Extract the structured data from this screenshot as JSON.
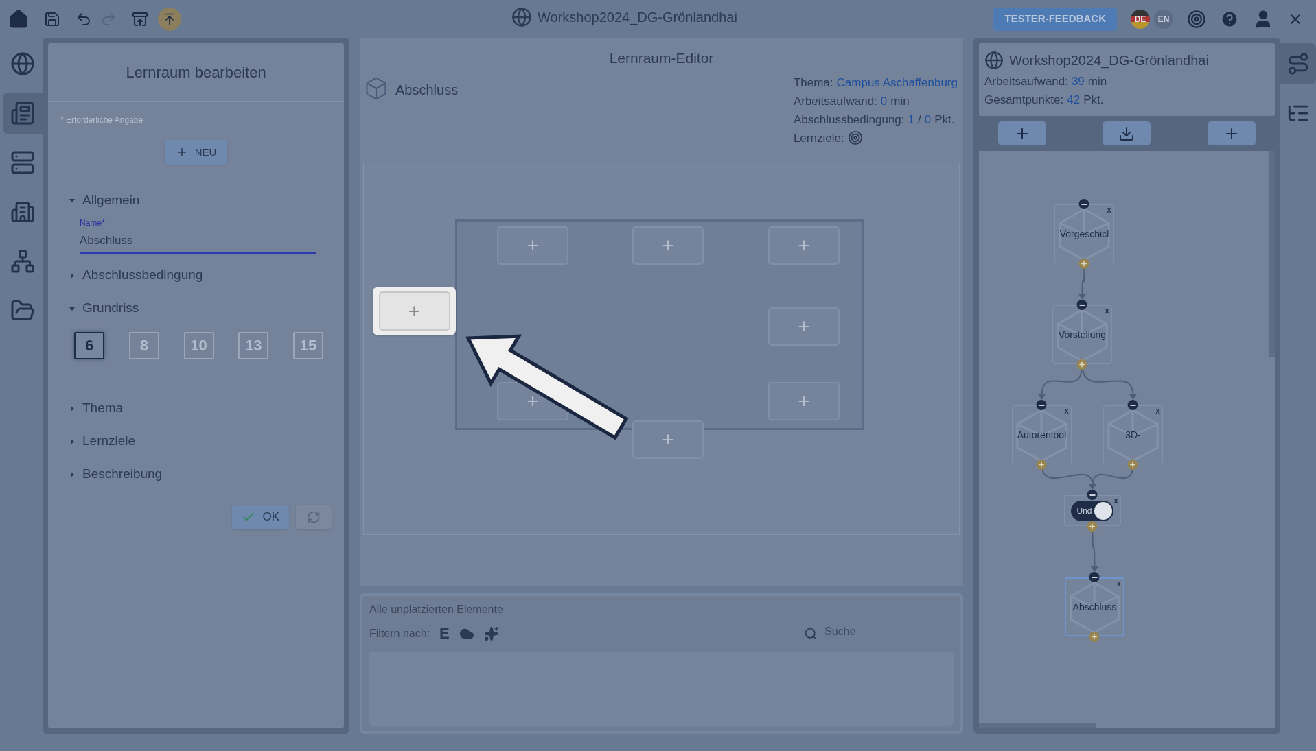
{
  "top_bar": {
    "title": "Workshop2024_DG-Grönlandhai",
    "feedback_button": "TESTER-FEEDBACK",
    "languages": [
      {
        "label": "DE",
        "selected": true
      },
      {
        "label": "EN",
        "selected": false
      }
    ],
    "redo_disabled": true
  },
  "left_rail": [
    {
      "selected": false
    },
    {
      "selected": true
    },
    {
      "selected": false
    },
    {
      "selected": false
    },
    {
      "selected": false
    },
    {
      "selected": false
    }
  ],
  "edit_panel": {
    "title": "Lernraum bearbeiten",
    "required_note": "* Erforderliche Angabe",
    "new_button": "NEU",
    "sections": [
      {
        "title": "Allgemein",
        "expanded": true,
        "kind": "general"
      },
      {
        "title": "Abschlussbedingung",
        "expanded": false
      },
      {
        "title": "Grundriss",
        "expanded": true,
        "kind": "floorplan"
      },
      {
        "title": "Thema",
        "expanded": false
      },
      {
        "title": "Lernziele",
        "expanded": false
      },
      {
        "title": "Beschreibung",
        "expanded": false
      }
    ],
    "name_field": {
      "label": "Name*",
      "value": "Abschluss"
    },
    "floorplans": [
      {
        "label": "6",
        "selected": true
      },
      {
        "label": "8",
        "selected": false
      },
      {
        "label": "10",
        "selected": false
      },
      {
        "label": "13",
        "selected": false
      },
      {
        "label": "15",
        "selected": false
      }
    ],
    "ok_button": "OK"
  },
  "editor": {
    "title": "Lernraum-Editor",
    "room_name": "Abschluss",
    "info": [
      [
        {
          "text": "Thema:",
          "kind": "label"
        },
        {
          "text": "Campus Aschaffenburg",
          "kind": "value"
        }
      ],
      [
        {
          "text": "Arbeitsaufwand:",
          "kind": "label"
        },
        {
          "text": "0",
          "kind": "value"
        },
        {
          "text": "min",
          "kind": "label"
        }
      ],
      [
        {
          "text": "Abschlussbedingung:",
          "kind": "label"
        },
        {
          "text": "1",
          "kind": "value"
        },
        {
          "text": "/",
          "kind": "label"
        },
        {
          "text": "0",
          "kind": "value"
        },
        {
          "text": "Pkt.",
          "kind": "label"
        }
      ],
      [
        {
          "text": "Lernziele:",
          "kind": "label"
        },
        {
          "kind": "icon"
        }
      ]
    ],
    "slots": [
      {
        "label": "+",
        "highlighted": false
      },
      {
        "label": "+",
        "highlighted": false
      },
      {
        "label": "+",
        "highlighted": false
      },
      {
        "label": "+",
        "highlighted": false
      },
      {
        "label": "+",
        "highlighted": false
      },
      {
        "label": "+",
        "highlighted": false
      },
      {
        "label": "+",
        "highlighted": false
      },
      {
        "label": "+",
        "highlighted": true
      }
    ]
  },
  "unplaced": {
    "title": "Alle unplatzierten Elemente",
    "filter_label": "Filtern nach:",
    "filters": [
      {
        "kind": "letter",
        "label": "E"
      },
      {
        "kind": "icon"
      },
      {
        "kind": "icon"
      }
    ],
    "search": {
      "placeholder": "Suche"
    }
  },
  "world_panel": {
    "title": "Workshop2024_DG-Grönlandhai",
    "stats": [
      [
        {
          "text": "Arbeitsaufwand:",
          "kind": "label"
        },
        {
          "text": "39",
          "kind": "value"
        },
        {
          "text": "min",
          "kind": "label"
        }
      ],
      [
        {
          "text": "Gesamtpunkte:",
          "kind": "label"
        },
        {
          "text": "42",
          "kind": "value"
        },
        {
          "text": "Pkt.",
          "kind": "label"
        }
      ]
    ],
    "nodes": [
      {
        "label": "Vorgeschicl",
        "kind": "space",
        "selected": false,
        "remove": "x"
      },
      {
        "label": "Vorstellung",
        "kind": "space",
        "selected": false,
        "remove": "x"
      },
      {
        "label": "Autorentool",
        "kind": "space",
        "selected": false,
        "remove": "x"
      },
      {
        "label": "3D-",
        "kind": "space",
        "selected": false,
        "remove": "x"
      },
      {
        "label": "Und",
        "kind": "condition",
        "selected": false,
        "remove": "x"
      },
      {
        "label": "Abschluss",
        "kind": "space",
        "selected": true,
        "remove": "x"
      }
    ]
  },
  "right_rail": [
    {
      "selected": true
    },
    {
      "selected": false
    }
  ]
}
